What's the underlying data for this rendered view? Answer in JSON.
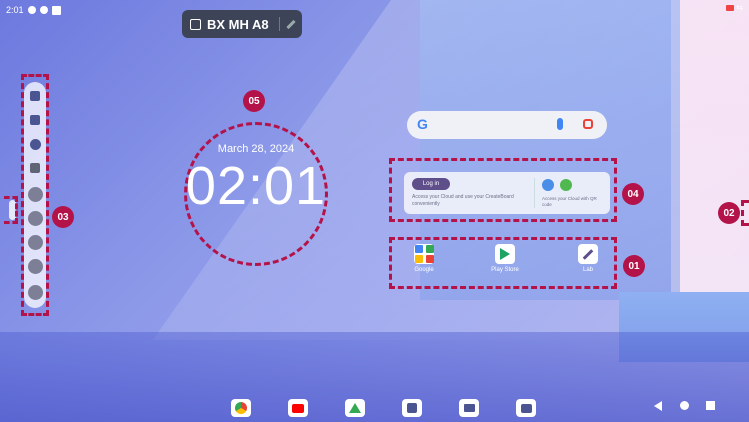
{
  "status_bar": {
    "time": "2:01"
  },
  "device_pill": {
    "name": "BX MH A8"
  },
  "clock": {
    "date": "March 28, 2024",
    "time": "02:01"
  },
  "cloud_widget": {
    "login_label": "Log in",
    "description": "Access your Cloud and use your CreateBoard conveniently",
    "qr_text": "Access your Cloud with QR code"
  },
  "apps": [
    {
      "label": "Google",
      "icon": "google-apps-folder-icon"
    },
    {
      "label": "Play Store",
      "icon": "play-store-icon"
    },
    {
      "label": "Lab",
      "icon": "lab-icon"
    }
  ],
  "badges": [
    "01",
    "02",
    "03",
    "04",
    "05"
  ],
  "colors": {
    "accent": "#b4134a",
    "login": "#5e4e8a"
  }
}
